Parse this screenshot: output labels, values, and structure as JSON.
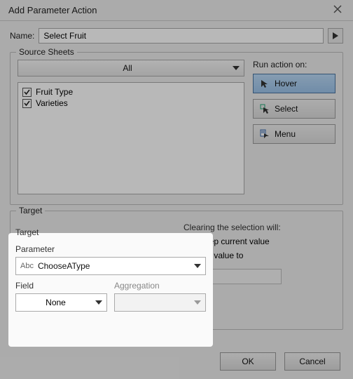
{
  "window": {
    "title": "Add Parameter Action"
  },
  "name": {
    "label": "Name:",
    "value": "Select Fruit"
  },
  "source_sheets": {
    "legend": "Source Sheets",
    "scope_selected": "All",
    "sheets": [
      {
        "label": "Fruit Type",
        "checked": true
      },
      {
        "label": "Varieties",
        "checked": true
      }
    ],
    "run_on_label": "Run action on:",
    "actions": {
      "hover": "Hover",
      "select": "Select",
      "menu": "Menu"
    },
    "selected_action": "hover"
  },
  "target": {
    "legend": "Target",
    "parameter_label": "Parameter",
    "parameter_prefix": "Abc",
    "parameter_value": "ChooseAType",
    "field_label": "Field",
    "field_value": "None",
    "aggregation_label": "Aggregation",
    "aggregation_value": ""
  },
  "clearing": {
    "label": "Clearing the selection will:",
    "keep_label": "Keep current value",
    "set_label": "Set value to",
    "selected": "keep",
    "set_value": ""
  },
  "buttons": {
    "ok": "OK",
    "cancel": "Cancel"
  }
}
